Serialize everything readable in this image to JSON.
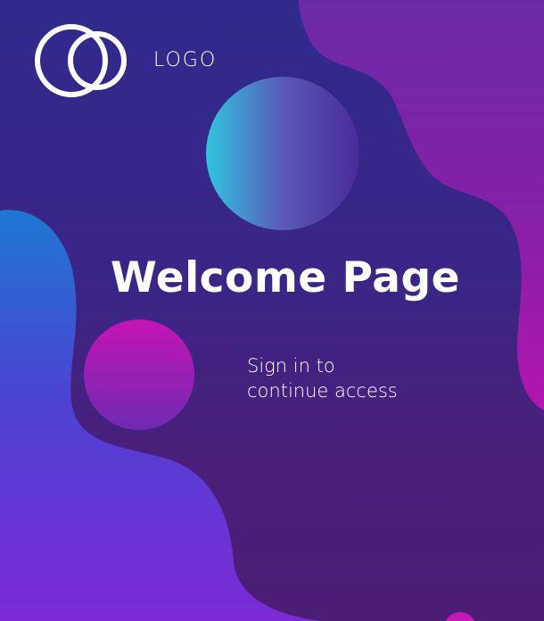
{
  "logo": {
    "text": "LOGO",
    "icon": "overlapping-rings-icon"
  },
  "welcome": {
    "title": "Welcome Page",
    "subtitle_line1": "Sign in to",
    "subtitle_line2": "continue access"
  },
  "colors": {
    "background": "#3a2786",
    "accent_magenta": "#c218b6",
    "accent_cyan": "#2fc0df",
    "accent_blue": "#2a7fd8",
    "text": "#ffffff"
  }
}
